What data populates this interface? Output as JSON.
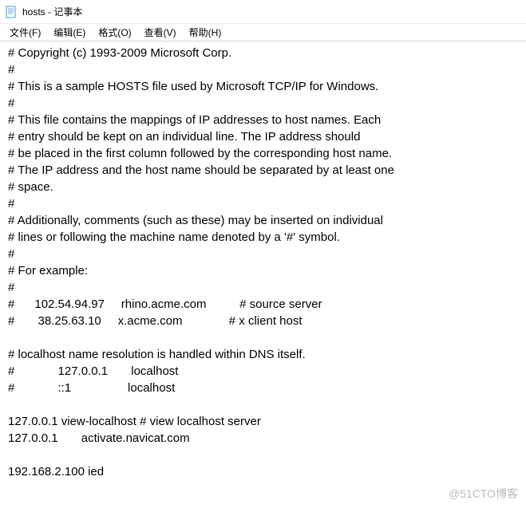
{
  "window": {
    "title": "hosts - 记事本"
  },
  "menu": {
    "file": "文件(F)",
    "edit": "编辑(E)",
    "format": "格式(O)",
    "view": "查看(V)",
    "help": "帮助(H)"
  },
  "content": {
    "text": "# Copyright (c) 1993-2009 Microsoft Corp.\n#\n# This is a sample HOSTS file used by Microsoft TCP/IP for Windows.\n#\n# This file contains the mappings of IP addresses to host names. Each\n# entry should be kept on an individual line. The IP address should\n# be placed in the first column followed by the corresponding host name.\n# The IP address and the host name should be separated by at least one\n# space.\n#\n# Additionally, comments (such as these) may be inserted on individual\n# lines or following the machine name denoted by a '#' symbol.\n#\n# For example:\n#\n#      102.54.94.97     rhino.acme.com          # source server\n#       38.25.63.10     x.acme.com              # x client host\n\n# localhost name resolution is handled within DNS itself.\n#             127.0.0.1       localhost\n#             ::1                 localhost\n\n127.0.0.1 view-localhost # view localhost server\n127.0.0.1       activate.navicat.com\n\n192.168.2.100 ied"
  },
  "watermark": "@51CTO博客"
}
